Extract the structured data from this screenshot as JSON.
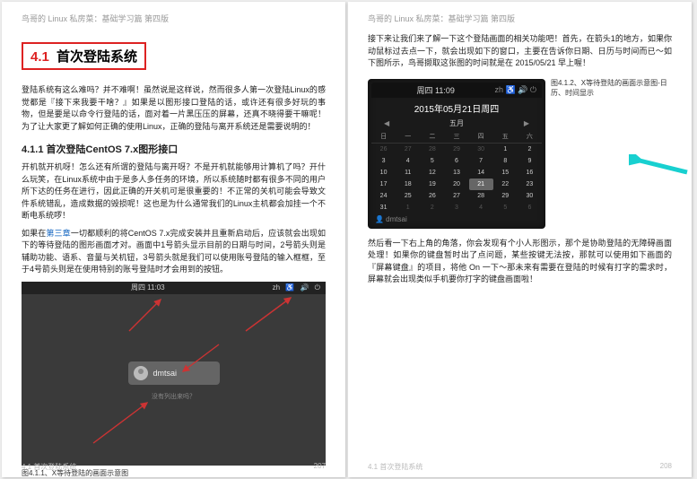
{
  "header": "鸟哥的 Linux 私房菜：基础学习篇 第四版",
  "left": {
    "section_num": "4.1",
    "section_title": "首次登陆系统",
    "p1": "登陆系统有这么难吗？并不难啊！虽然说是这样说，然而很多人第一次登陆Linux的感觉都是『接下来我要干啥？』如果是以图形接口登陆的话，或许还有很多好玩的事物，但是要是以命令行登陆的话，面对着一片黑压压的屏幕，还真不晓得要干嘛呢！为了让大家更了解如何正确的使用Linux，正确的登陆与离开系统还是需要说明的！",
    "sub": "4.1.1 首次登陆CentOS 7.x图形接口",
    "p2": "开机就开机呀！怎么还有所谓的登陆与离开呀？不是开机就能够用计算机了吗？开什么玩笑，在Linux系统中由于是多人多任务的环境，所以系统随时都有很多不同的用户所下达的任务在进行，因此正确的开关机可是很重要的！不正常的关机可能会导致文件系统错乱，造成数据的毁损呢！这也是为什么通常我们的Linux主机都会加挂一个不断电系统啰！",
    "p3_a": "如果在",
    "p3_link": "第三章",
    "p3_b": "一切都顺利的将CentOS 7.x完成安装并且重新启动后，应该就会出现如下的等待登陆的图形画面才对。画面中1号箭头显示目前的日期与时间，2号箭头则是辅助功能、语系、音量与关机钮，3号箭头就是我们可以使用账号登陆的输入框框，至于4号箭头则是在使用特别的账号登陆时才会用到的按钮。",
    "shot": {
      "time": "周四 11:03",
      "icons": [
        "zh",
        "♿",
        "🔊",
        "⏻"
      ],
      "user": "dmtsai",
      "hint": "没有列出来吗？"
    },
    "cap": "图4.1.1、X等待登陆的画面示意图",
    "footer_l": "4.1 首次登陆系统",
    "footer_r": "207"
  },
  "right": {
    "p1": "接下来让我们来了解一下这个登陆画面的相关功能吧！首先，在箭头1的地方，如果你动鼠标过去点一下，就会出现如下的窗口，主要在告诉你日期、日历与时间而已～如下图所示，鸟哥撷取这张图的时间就是在 2015/05/21 早上喔！",
    "cal": {
      "topbar": "周四 11:09",
      "date": "2015年05月21日周四",
      "month": "五月",
      "dow": [
        "日",
        "一",
        "二",
        "三",
        "四",
        "五",
        "六"
      ],
      "grid": [
        [
          {
            "d": "26",
            "dim": 1
          },
          {
            "d": "27",
            "dim": 1
          },
          {
            "d": "28",
            "dim": 1
          },
          {
            "d": "29",
            "dim": 1
          },
          {
            "d": "30",
            "dim": 1
          },
          {
            "d": "1"
          },
          {
            "d": "2"
          }
        ],
        [
          {
            "d": "3"
          },
          {
            "d": "4"
          },
          {
            "d": "5"
          },
          {
            "d": "6"
          },
          {
            "d": "7"
          },
          {
            "d": "8"
          },
          {
            "d": "9"
          }
        ],
        [
          {
            "d": "10"
          },
          {
            "d": "11"
          },
          {
            "d": "12"
          },
          {
            "d": "13"
          },
          {
            "d": "14"
          },
          {
            "d": "15"
          },
          {
            "d": "16"
          }
        ],
        [
          {
            "d": "17"
          },
          {
            "d": "18"
          },
          {
            "d": "19"
          },
          {
            "d": "20"
          },
          {
            "d": "21",
            "sel": 1
          },
          {
            "d": "22"
          },
          {
            "d": "23"
          }
        ],
        [
          {
            "d": "24"
          },
          {
            "d": "25"
          },
          {
            "d": "26"
          },
          {
            "d": "27"
          },
          {
            "d": "28"
          },
          {
            "d": "29"
          },
          {
            "d": "30"
          }
        ],
        [
          {
            "d": "31"
          },
          {
            "d": "1",
            "dim": 1
          },
          {
            "d": "2",
            "dim": 1
          },
          {
            "d": "3",
            "dim": 1
          },
          {
            "d": "4",
            "dim": 1
          },
          {
            "d": "5",
            "dim": 1
          },
          {
            "d": "6",
            "dim": 1
          }
        ]
      ],
      "user": "👤 dmtsai"
    },
    "cap": "图4.1.2、X等待登陆的画面示意图-日历、时间显示",
    "p2": "然后看一下右上角的角落，你会发现有个小人形图示，那个是协助登陆的无障碍画面处理！如果你的键盘暂时出了点问题，某些按键无法按，那就可以使用如下画面的『屏幕键盘』的项目，将他 On 一下～那未来有需要在登陆的时候有打字的需求时，屏幕就会出现类似手机要你打字的键盘画面啦！",
    "footer_l": "4.1 首次登陆系统",
    "footer_r": "208"
  }
}
